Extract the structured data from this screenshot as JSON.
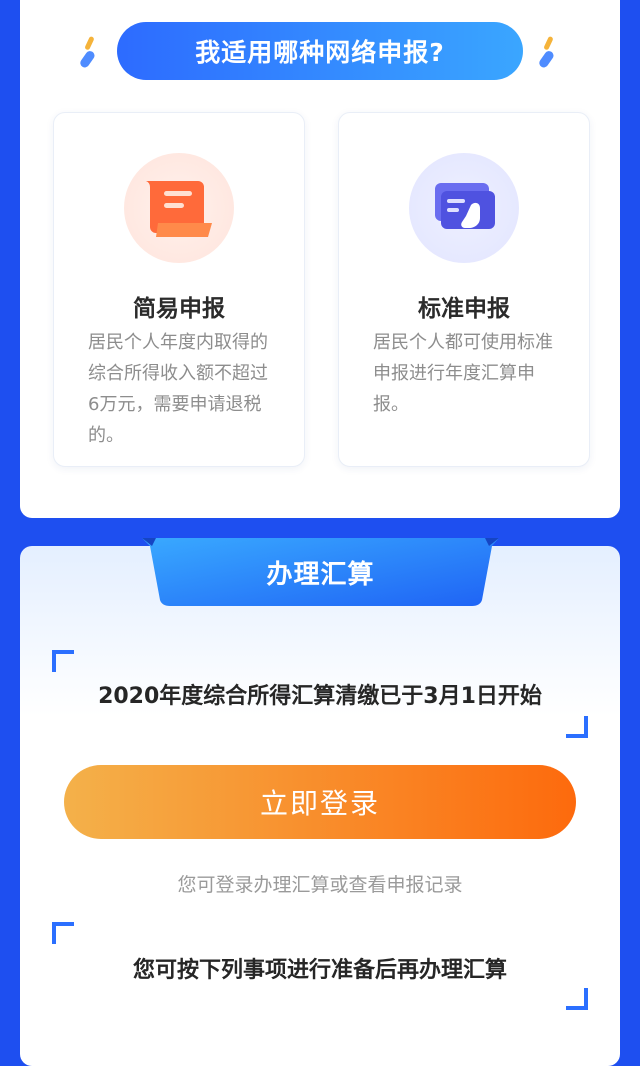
{
  "network_choice": {
    "title": "我适用哪种网络申报?",
    "options": [
      {
        "title": "简易申报",
        "description": "居民个人年度内取得的综合所得收入额不超过6万元，需要申请退税的。",
        "icon": "scroll-document-icon"
      },
      {
        "title": "标准申报",
        "description": "居民个人都可使用标准申报进行年度汇算申报。",
        "icon": "hand-on-card-icon"
      }
    ]
  },
  "settlement": {
    "banner": "办理汇算",
    "start_notice": "2020年度综合所得汇算清缴已于3月1日开始",
    "login_button": "立即登录",
    "login_hint": "您可登录办理汇算或查看申报记录",
    "prepare_notice": "您可按下列事项进行准备后再办理汇算"
  },
  "colors": {
    "background": "#1e4ff0",
    "accent_blue": "#2d6bff",
    "button_start": "#f4b14a",
    "button_end": "#fd6a0d"
  }
}
